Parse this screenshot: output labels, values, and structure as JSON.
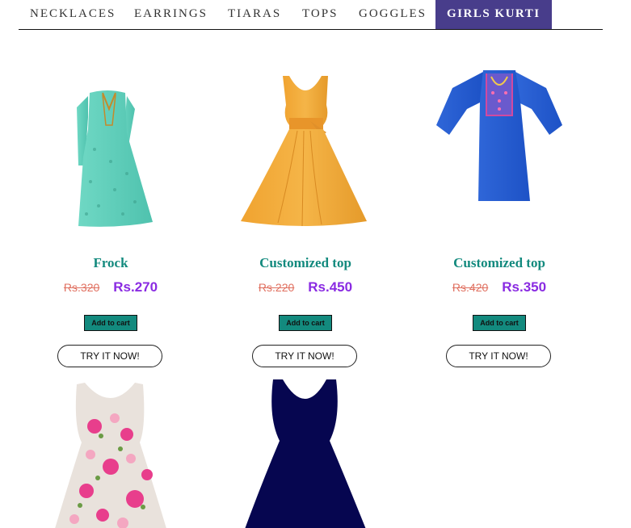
{
  "nav": {
    "items": [
      "NECKLACES",
      "EARRINGS",
      "TIARAS",
      "TOPS",
      "GOGGLES",
      "GIRLS KURTI"
    ],
    "active_index": 5,
    "active_color": "#483d8b"
  },
  "products": [
    {
      "name": "Frock",
      "old_price": "Rs.320",
      "new_price": "Rs.270",
      "cart_label": "Add to cart",
      "try_label": "TRY IT NOW!",
      "image": "mint-green-anarkali-dress"
    },
    {
      "name": "Customized top",
      "old_price": "Rs.220",
      "new_price": "Rs.450",
      "cart_label": "Add to cart",
      "try_label": "TRY IT NOW!",
      "image": "orange-sleeveless-flared-dress"
    },
    {
      "name": "Customized top",
      "old_price": "Rs.420",
      "new_price": "Rs.350",
      "cart_label": "Add to cart",
      "try_label": "TRY IT NOW!",
      "image": "blue-embroidered-kurti"
    },
    {
      "image": "floral-print-sleeveless-dress"
    },
    {
      "image": "navy-sleeveless-dress"
    }
  ],
  "colors": {
    "product_name": "#138a7e",
    "new_price": "#8a2be2",
    "old_price": "#e07060",
    "cart_button": "#138a7e"
  }
}
